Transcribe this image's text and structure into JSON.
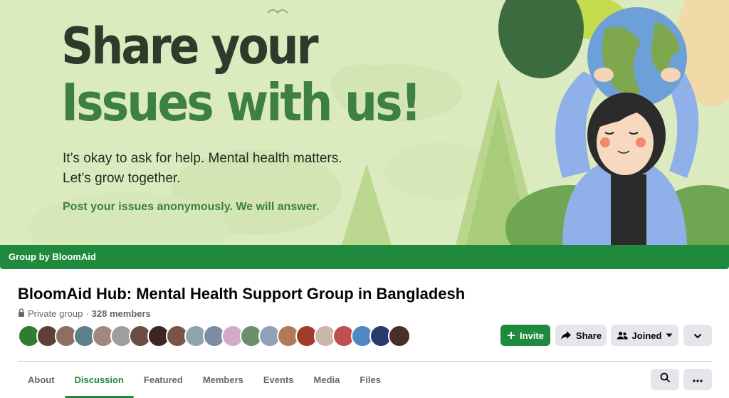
{
  "cover": {
    "headline_line1": "Share your",
    "headline_line2": "Issues with us!",
    "subtext_line1": "It’s okay to ask for help. Mental health matters.",
    "subtext_line2": "Let’s grow together.",
    "cta": "Post your issues anonymously. We will answer."
  },
  "group_bar": {
    "label": "Group by BloomAid"
  },
  "group": {
    "title": "BloomAid Hub: Mental Health Support Group in Bangladesh",
    "privacy": "Private group",
    "separator": "·",
    "members": "328 members"
  },
  "actions": {
    "invite_label": "Invite",
    "share_label": "Share",
    "joined_label": "Joined"
  },
  "tabs": [
    {
      "label": "About",
      "active": false
    },
    {
      "label": "Discussion",
      "active": true
    },
    {
      "label": "Featured",
      "active": false
    },
    {
      "label": "Members",
      "active": false
    },
    {
      "label": "Events",
      "active": false
    },
    {
      "label": "Media",
      "active": false
    },
    {
      "label": "Files",
      "active": false
    }
  ],
  "avatar_colors": [
    "#2e7d32",
    "#5d4037",
    "#8d6e63",
    "#607d8b",
    "#a1887f",
    "#9e9e9e",
    "#6d4c41",
    "#3e2723",
    "#795548",
    "#90a4ae",
    "#7b8ca3",
    "#d7a9c8",
    "#6b8e6b",
    "#8fa3b8",
    "#b07a5a",
    "#a23b2a",
    "#c9b8a6",
    "#c0504d",
    "#4f86c6",
    "#2a3a6a",
    "#4a2e2a"
  ],
  "colors": {
    "brand_green": "#1f8a3d",
    "cover_bg": "#dcebbf",
    "headline_dark": "#2f3a2a",
    "headline_green": "#3e7f43",
    "button_gray": "#e4e6eb",
    "muted_text": "#65676b"
  },
  "icons": [
    "lock-icon",
    "plus-icon",
    "share-arrow-icon",
    "people-icon",
    "caret-down-icon",
    "chevron-down-icon",
    "search-icon",
    "ellipsis-icon"
  ]
}
